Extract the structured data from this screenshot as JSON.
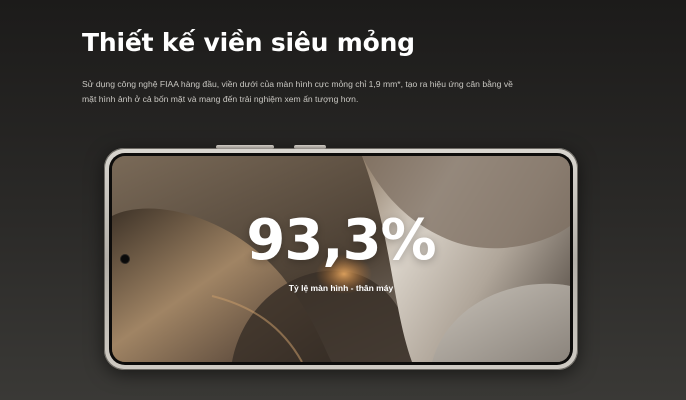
{
  "section": {
    "title": "Thiết kế viền siêu mỏng",
    "description": "Sử dụng công nghệ FIAA hàng đầu, viền dưới của màn hình cực mỏng chỉ 1,9 mm*, tạo ra hiệu ứng cân bằng về mặt hình ảnh ở cả bốn mặt và mang đến trải nghiệm xem ấn tượng hơn."
  },
  "phone_visual": {
    "ratio_value": "93,3%",
    "ratio_caption": "Tỷ lệ màn hình - thân máy"
  },
  "colors": {
    "background": "#232221",
    "frame": "#c9c5be",
    "text": "#ffffff",
    "wallpaper_warm": "#b98a5a"
  }
}
